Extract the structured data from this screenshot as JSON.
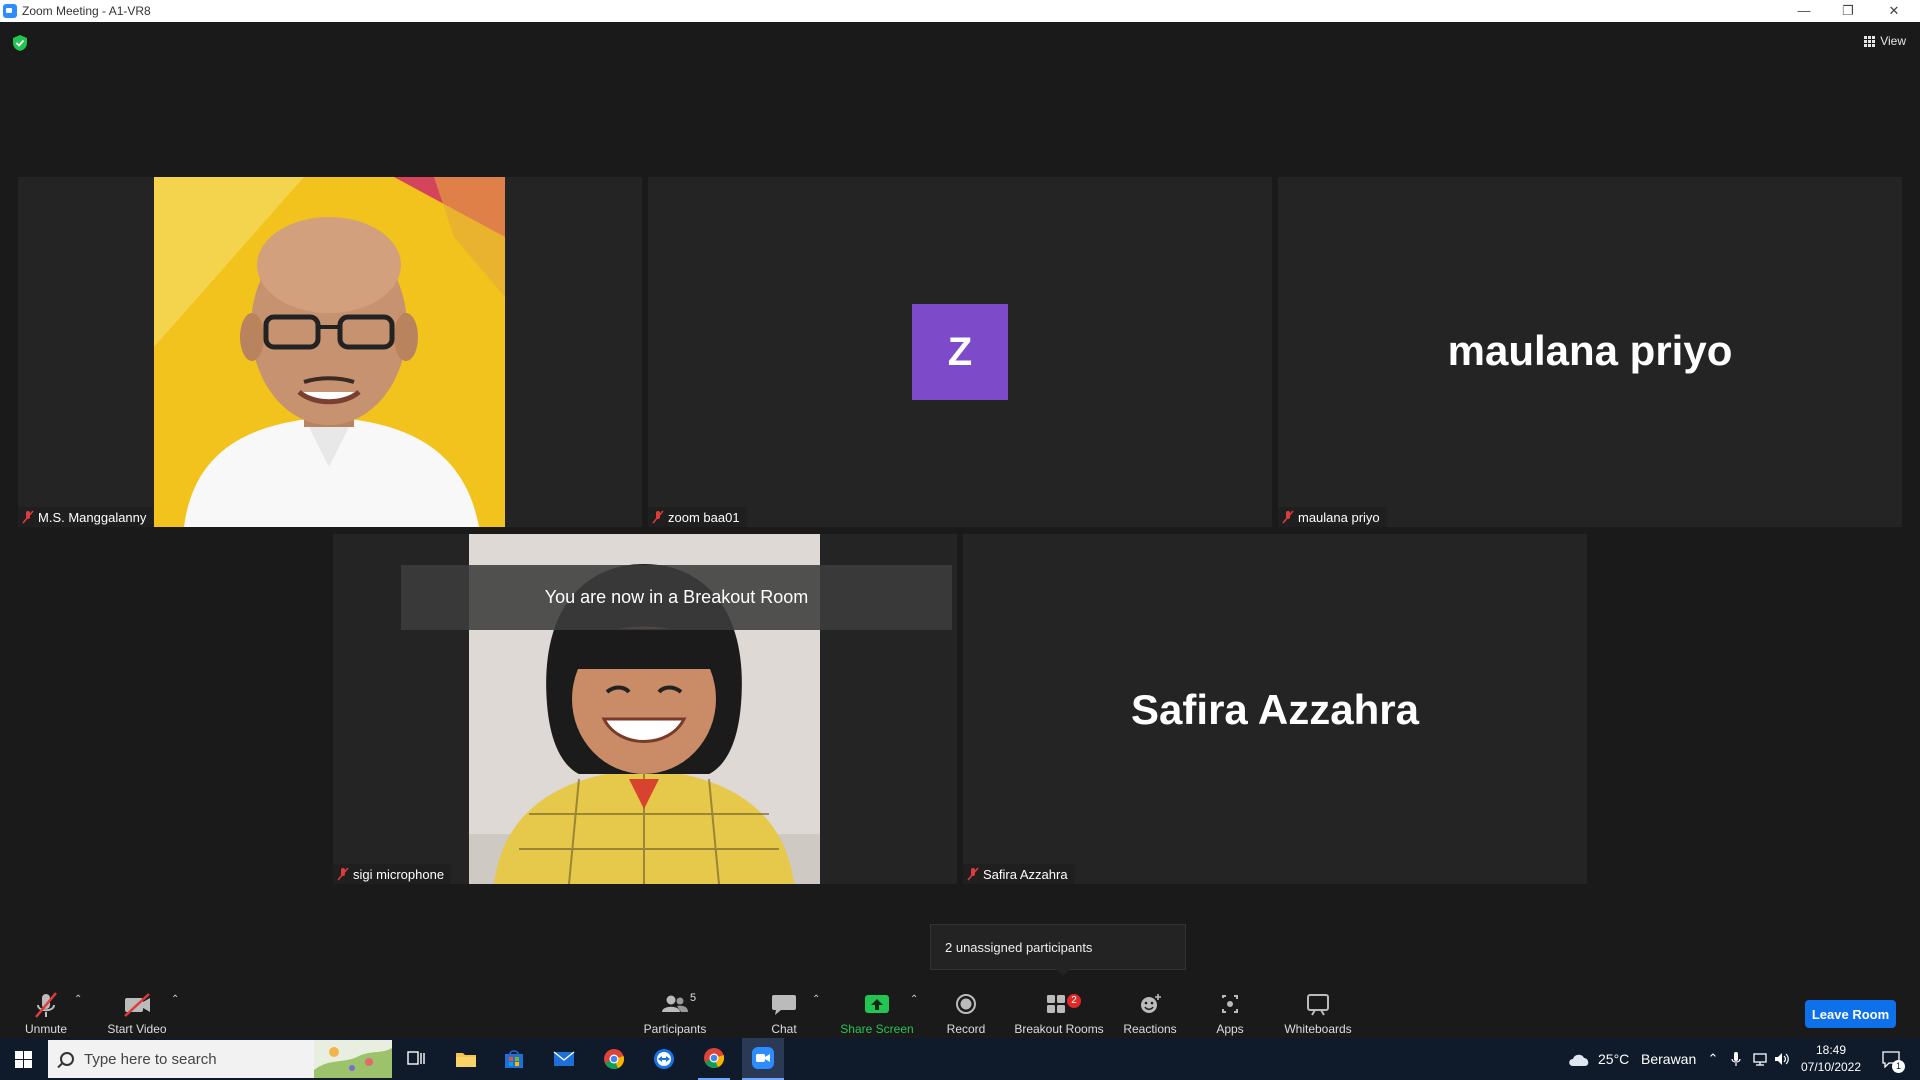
{
  "window": {
    "title": "Zoom Meeting - A1-VR8"
  },
  "top_bar": {
    "view_label": "View"
  },
  "tiles": [
    {
      "name": "M.S. Manggalanny"
    },
    {
      "name": "zoom baa01",
      "avatar_letter": "Z"
    },
    {
      "name": "maulana priyo",
      "display_name": "maulana priyo"
    },
    {
      "name": "sigi microphone"
    },
    {
      "name": "Safira Azzahra",
      "display_name": "Safira Azzahra"
    }
  ],
  "notification": "You are now in a Breakout Room",
  "tooltip": "2 unassigned participants",
  "toolbar": {
    "unmute": "Unmute",
    "start_video": "Start Video",
    "participants": "Participants",
    "participants_count": "5",
    "chat": "Chat",
    "share_screen": "Share Screen",
    "record": "Record",
    "breakout_rooms": "Breakout Rooms",
    "breakout_badge": "2",
    "reactions": "Reactions",
    "apps": "Apps",
    "whiteboards": "Whiteboards",
    "leave_room": "Leave Room"
  },
  "taskbar": {
    "search_placeholder": "Type here to search",
    "weather_temp": "25°C",
    "weather_desc": "Berawan",
    "time": "18:49",
    "date": "07/10/2022",
    "notification_count": "1"
  },
  "colors": {
    "accent": "#0e71eb",
    "avatar": "#7d4ac9",
    "share_green": "#23c552",
    "badge_red": "#e02828"
  }
}
